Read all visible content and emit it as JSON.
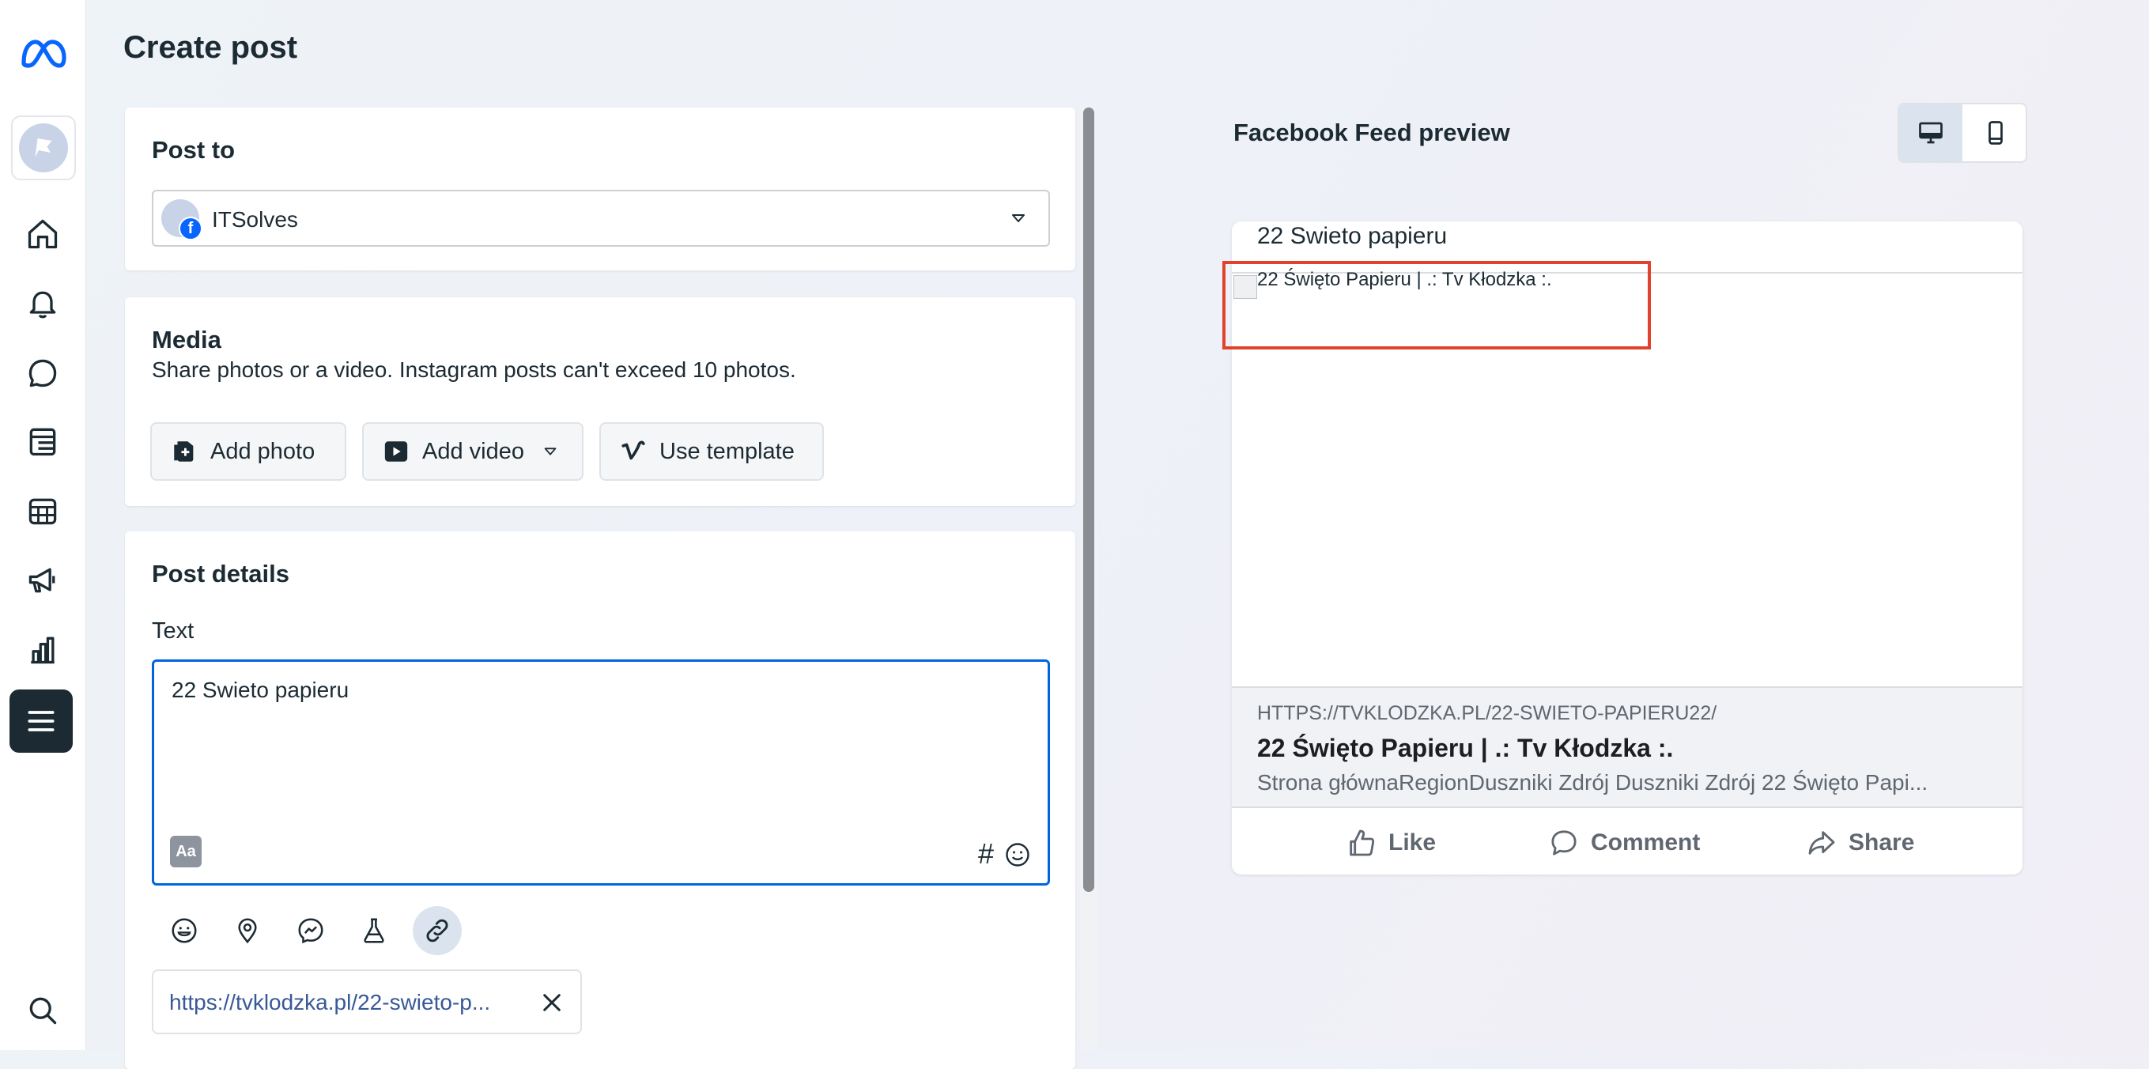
{
  "page_title": "Create post",
  "sidebar": {
    "items": [
      "meta-logo",
      "page-avatar",
      "home",
      "notifications",
      "messages",
      "posts",
      "calendar",
      "ads",
      "insights",
      "menu",
      "search"
    ]
  },
  "post_to": {
    "title": "Post to",
    "selected_account": "ITSolves"
  },
  "media": {
    "title": "Media",
    "description": "Share photos or a video. Instagram posts can't exceed 10 photos.",
    "add_photo": "Add photo",
    "add_video": "Add video",
    "use_template": "Use template"
  },
  "post_details": {
    "title": "Post details",
    "text_label": "Text",
    "text_value": "22 Swieto papieru",
    "format_badge": "Aa",
    "hashtag": "#",
    "link_chip": "https://tvklodzka.pl/22-swieto-p..."
  },
  "preview": {
    "title": "Facebook Feed preview",
    "post_text": "22 Swieto papieru",
    "image_alt": "22 Święto Papieru | .: Tv Kłodzka :.",
    "link_domain": "HTTPS://TVKLODZKA.PL/22-SWIETO-PAPIERU22/",
    "link_title": "22 Święto Papieru | .: Tv Kłodzka :.",
    "link_description": "Strona głównaRegionDuszniki Zdrój Duszniki Zdrój 22 Święto Papi...",
    "like": "Like",
    "comment": "Comment",
    "share": "Share"
  },
  "colors": {
    "accent": "#0064e0",
    "link": "#385898",
    "highlight_box": "#e0432c"
  }
}
